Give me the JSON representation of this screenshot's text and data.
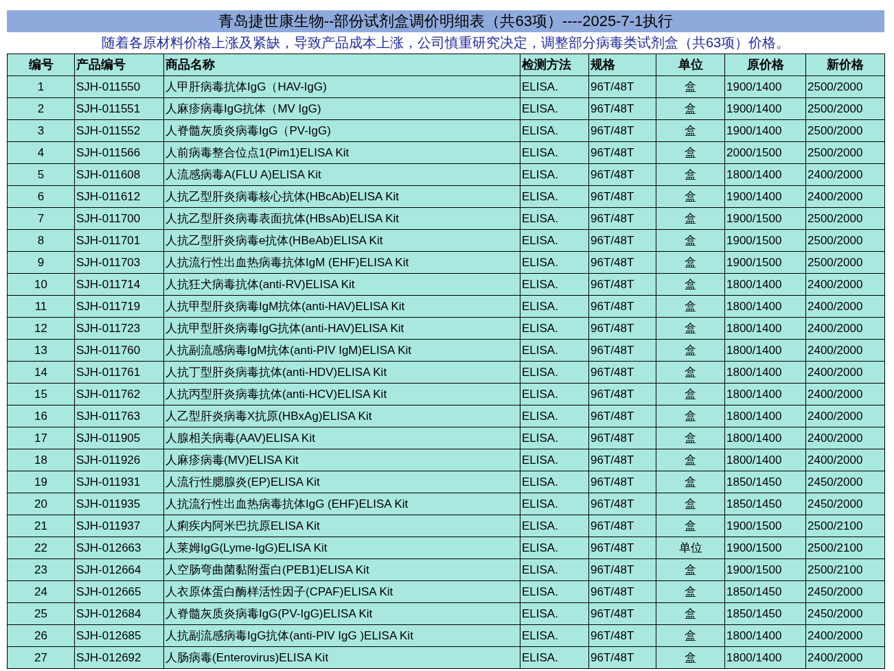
{
  "title": "青岛捷世康生物--部份试剂盒调价明细表（共63项）----2025-7-1执行",
  "notice": "随着各原材料价格上涨及紧缺，导致产品成本上涨，公司慎重研究决定，调整部分病毒类试剂盒（共63项）价格。",
  "table": {
    "columns": [
      "编号",
      "产品编号",
      "商品名称",
      "检测方法",
      "规格",
      "单位",
      "原价格",
      "新价格"
    ],
    "rows": [
      [
        "1",
        "SJH-011550",
        "人甲肝病毒抗体IgG（HAV-IgG)",
        "ELISA.",
        "96T/48T",
        "盒",
        "1900/1400",
        "2500/2000"
      ],
      [
        "2",
        "SJH-011551",
        "人麻疹病毒IgG抗体（MV IgG)",
        "ELISA.",
        "96T/48T",
        "盒",
        "1900/1400",
        "2500/2000"
      ],
      [
        "3",
        "SJH-011552",
        "人脊髓灰质炎病毒IgG（PV-IgG)",
        "ELISA.",
        "96T/48T",
        "盒",
        "1900/1400",
        "2500/2000"
      ],
      [
        "4",
        "SJH-011566",
        "人前病毒整合位点1(Pim1)ELISA Kit",
        "ELISA.",
        "96T/48T",
        "盒",
        "2000/1500",
        "2500/2000"
      ],
      [
        "5",
        "SJH-011608",
        "人流感病毒A(FLU A)ELISA Kit",
        "ELISA.",
        "96T/48T",
        "盒",
        "1800/1400",
        "2400/2000"
      ],
      [
        "6",
        "SJH-011612",
        "人抗乙型肝炎病毒核心抗体(HBcAb)ELISA Kit",
        "ELISA.",
        "96T/48T",
        "盒",
        "1900/1400",
        "2400/2000"
      ],
      [
        "7",
        "SJH-011700",
        "人抗乙型肝炎病毒表面抗体(HBsAb)ELISA Kit",
        "ELISA.",
        "96T/48T",
        "盒",
        "1900/1500",
        "2500/2000"
      ],
      [
        "8",
        "SJH-011701",
        "人抗乙型肝炎病毒e抗体(HBeAb)ELISA Kit",
        "ELISA.",
        "96T/48T",
        "盒",
        "1900/1500",
        "2500/2000"
      ],
      [
        "9",
        "SJH-011703",
        "人抗流行性出血热病毒抗体IgM (EHF)ELISA Kit",
        "ELISA.",
        "96T/48T",
        "盒",
        "1900/1500",
        "2500/2000"
      ],
      [
        "10",
        "SJH-011714",
        "人抗狂犬病毒抗体(anti-RV)ELISA Kit",
        "ELISA.",
        "96T/48T",
        "盒",
        "1800/1400",
        "2400/2000"
      ],
      [
        "11",
        "SJH-011719",
        "人抗甲型肝炎病毒IgM抗体(anti-HAV)ELISA Kit",
        "ELISA.",
        "96T/48T",
        "盒",
        "1800/1400",
        "2400/2000"
      ],
      [
        "12",
        "SJH-011723",
        "人抗甲型肝炎病毒IgG抗体(anti-HAV)ELISA Kit",
        "ELISA.",
        "96T/48T",
        "盒",
        "1800/1400",
        "2400/2000"
      ],
      [
        "13",
        "SJH-011760",
        "人抗副流感病毒IgM抗体(anti-PIV IgM)ELISA Kit",
        "ELISA.",
        "96T/48T",
        "盒",
        "1800/1400",
        "2400/2000"
      ],
      [
        "14",
        "SJH-011761",
        "人抗丁型肝炎病毒抗体(anti-HDV)ELISA Kit",
        "ELISA.",
        "96T/48T",
        "盒",
        "1800/1400",
        "2400/2000"
      ],
      [
        "15",
        "SJH-011762",
        "人抗丙型肝炎病毒抗体(anti-HCV)ELISA Kit",
        "ELISA.",
        "96T/48T",
        "盒",
        "1800/1400",
        "2400/2000"
      ],
      [
        "16",
        "SJH-011763",
        "人乙型肝炎病毒X抗原(HBxAg)ELISA Kit",
        "ELISA.",
        "96T/48T",
        "盒",
        "1800/1400",
        "2400/2000"
      ],
      [
        "17",
        "SJH-011905",
        "人腺相关病毒(AAV)ELISA Kit",
        "ELISA.",
        "96T/48T",
        "盒",
        "1800/1400",
        "2400/2000"
      ],
      [
        "18",
        "SJH-011926",
        "人麻疹病毒(MV)ELISA Kit",
        "ELISA.",
        "96T/48T",
        "盒",
        "1800/1400",
        "2400/2000"
      ],
      [
        "19",
        "SJH-011931",
        "人流行性腮腺炎(EP)ELISA Kit",
        "ELISA.",
        "96T/48T",
        "盒",
        "1850/1450",
        "2450/2000"
      ],
      [
        "20",
        "SJH-011935",
        "人抗流行性出血热病毒抗体IgG (EHF)ELISA Kit",
        "ELISA.",
        "96T/48T",
        "盒",
        "1850/1450",
        "2450/2000"
      ],
      [
        "21",
        "SJH-011937",
        "人痢疾内阿米巴抗原ELISA Kit",
        "ELISA.",
        "96T/48T",
        "盒",
        "1900/1500",
        "2500/2100"
      ],
      [
        "22",
        "SJH-012663",
        "人莱姆IgG(Lyme-IgG)ELISA Kit",
        "ELISA.",
        "96T/48T",
        "单位",
        "1900/1500",
        "2500/2100"
      ],
      [
        "23",
        "SJH-012664",
        "人空肠弯曲菌黏附蛋白(PEB1)ELISA Kit",
        "ELISA.",
        "96T/48T",
        "盒",
        "1900/1500",
        "2500/2100"
      ],
      [
        "24",
        "SJH-012665",
        "人衣原体蛋白酶样活性因子(CPAF)ELISA Kit",
        "ELISA.",
        "96T/48T",
        "盒",
        "1850/1450",
        "2450/2000"
      ],
      [
        "25",
        "SJH-012684",
        "人脊髓灰质炎病毒IgG(PV-IgG)ELISA Kit",
        "ELISA.",
        "96T/48T",
        "盒",
        "1850/1450",
        "2450/2000"
      ],
      [
        "26",
        "SJH-012685",
        "人抗副流感病毒IgG抗体(anti-PIV IgG )ELISA Kit",
        "ELISA.",
        "96T/48T",
        "盒",
        "1800/1400",
        "2400/2000"
      ],
      [
        "27",
        "SJH-012692",
        "人肠病毒(Enterovirus)ELISA Kit",
        "ELISA.",
        "96T/48T",
        "盒",
        "1800/1400",
        "2400/2000"
      ]
    ]
  }
}
